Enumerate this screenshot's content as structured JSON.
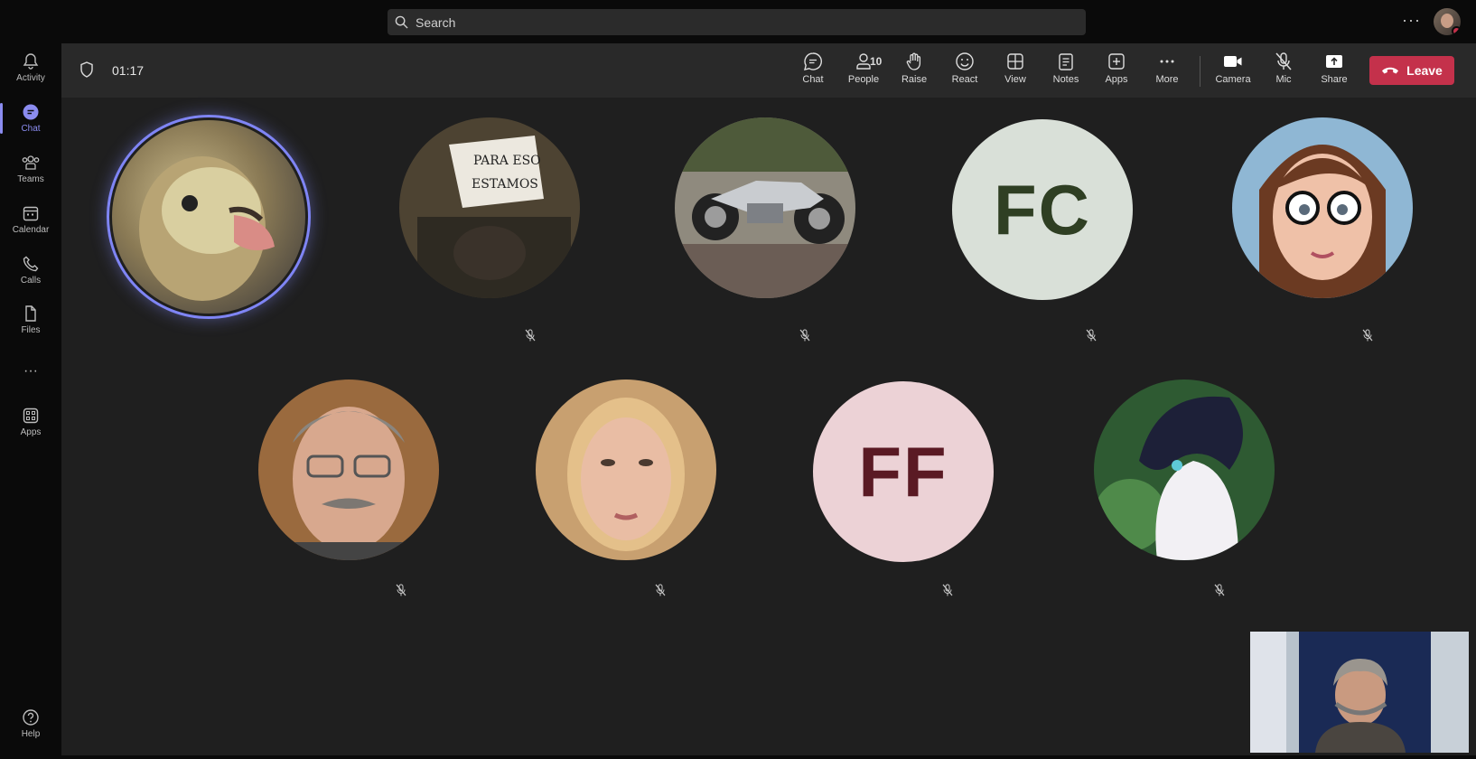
{
  "search": {
    "placeholder": "Search"
  },
  "topbar": {
    "more_label": "···"
  },
  "rail": {
    "items": [
      {
        "label": "Activity"
      },
      {
        "label": "Chat"
      },
      {
        "label": "Teams"
      },
      {
        "label": "Calendar"
      },
      {
        "label": "Calls"
      },
      {
        "label": "Files"
      },
      {
        "label": "···"
      },
      {
        "label": "Apps"
      },
      {
        "label": "Help"
      }
    ]
  },
  "meeting": {
    "timer": "01:17",
    "toolbar": {
      "chat": "Chat",
      "people": "People",
      "people_count": "10",
      "raise": "Raise",
      "react": "React",
      "view": "View",
      "notes": "Notes",
      "apps": "Apps",
      "more": "More",
      "camera": "Camera",
      "mic": "Mic",
      "share": "Share",
      "leave": "Leave"
    },
    "participants": [
      {
        "initials": "FC",
        "bg": "#d9e0d8",
        "fg": "#2f3f23"
      },
      {
        "initials": "FF",
        "bg": "#ecd2d6",
        "fg": "#5a1a24"
      }
    ]
  },
  "colors": {
    "accent": "#7f85f5",
    "leave": "#c4314b",
    "stage": "#1f1f1f"
  }
}
